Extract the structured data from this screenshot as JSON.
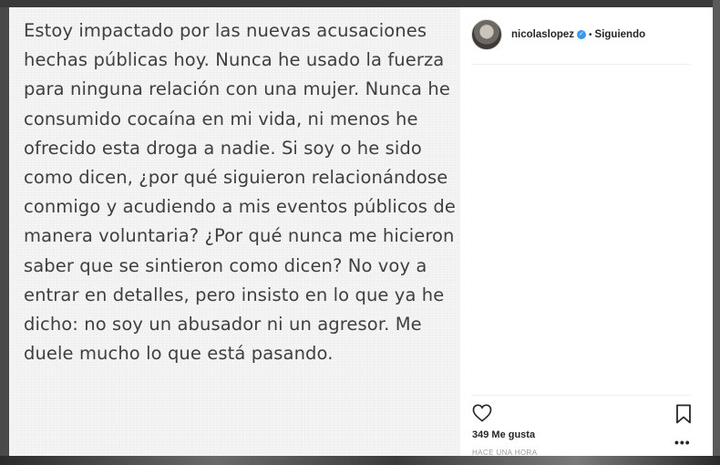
{
  "post": {
    "text": "Estoy impactado por las nuevas acusaciones hechas públicas hoy. Nunca he usado la fuerza para ninguna relación con una mujer. Nunca he consumido cocaína en mi vida, ni menos he ofrecido esta droga a nadie. Si soy o he sido como dicen, ¿por qué siguieron relacionándose conmigo y acudiendo a mis eventos públicos de manera voluntaria? ¿Por qué nunca me hicieron saber que se sintieron como dicen? No voy a entrar en detalles, pero insisto en lo que ya he dicho: no soy un abusador ni un agresor. Me duele mucho lo que está pasando."
  },
  "header": {
    "username": "nicolaslopez",
    "separator": "•",
    "follow_status": "Siguiendo",
    "verified_icon": "verified-badge-icon",
    "verified_color": "#3897f0"
  },
  "footer": {
    "likes": "349 Me gusta",
    "timestamp": "HACE UNA HORA"
  },
  "icons": {
    "like": "heart-icon",
    "save": "bookmark-icon",
    "more": "more-options-icon"
  }
}
